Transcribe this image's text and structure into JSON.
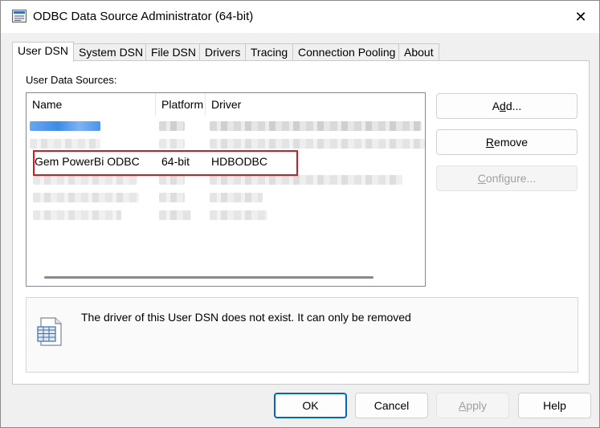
{
  "window": {
    "title": "ODBC Data Source Administrator (64-bit)",
    "close_glyph": "✕"
  },
  "tabs": [
    {
      "label": "User DSN",
      "active": true
    },
    {
      "label": "System DSN",
      "active": false
    },
    {
      "label": "File DSN",
      "active": false
    },
    {
      "label": "Drivers",
      "active": false
    },
    {
      "label": "Tracing",
      "active": false
    },
    {
      "label": "Connection Pooling",
      "active": false
    },
    {
      "label": "About",
      "active": false
    }
  ],
  "user_dsn": {
    "section_label": "User Data Sources:",
    "columns": {
      "name": "Name",
      "platform": "Platform",
      "driver": "Driver"
    },
    "rows": [
      {
        "name": "",
        "platform": "",
        "driver": "",
        "redacted": true
      },
      {
        "name": "",
        "platform": "",
        "driver": "",
        "redacted": true
      },
      {
        "name": "Gem PowerBi ODBC",
        "platform": "64-bit",
        "driver": "HDBODBC",
        "redacted": false,
        "highlighted": true
      },
      {
        "name": "",
        "platform": "",
        "driver": "",
        "redacted": true
      },
      {
        "name": "",
        "platform": "",
        "driver": "",
        "redacted": true
      },
      {
        "name": "",
        "platform": "",
        "driver": "",
        "redacted": true
      }
    ],
    "side_buttons": {
      "add": {
        "label": "Add...",
        "mnemonic": "d",
        "enabled": true
      },
      "remove": {
        "label": "Remove",
        "mnemonic": "R",
        "enabled": true
      },
      "configure": {
        "label": "Configure...",
        "mnemonic": "C",
        "enabled": false
      }
    },
    "info_message": "The driver of this User DSN does not exist. It can only be removed",
    "info_icon": "data-table-icon"
  },
  "footer_buttons": {
    "ok": {
      "label": "OK",
      "enabled": true
    },
    "cancel": {
      "label": "Cancel",
      "enabled": true
    },
    "apply": {
      "label": "Apply",
      "mnemonic": "A",
      "enabled": false
    },
    "help": {
      "label": "Help",
      "enabled": true
    }
  },
  "colors": {
    "highlight_border": "#e0161b",
    "focus_accent": "#0067c0",
    "redaction_blue": "#3d8ce8"
  }
}
